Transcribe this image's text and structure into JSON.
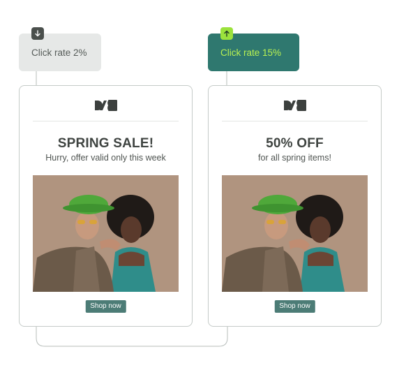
{
  "variant_a": {
    "metric_label": "Click rate 2%",
    "trend": "down",
    "trend_icon": "arrow-down-icon",
    "headline": "SPRING SALE!",
    "subline": "Hurry, offer valid only this week",
    "cta_label": "Shop now"
  },
  "variant_b": {
    "metric_label": "Click rate 15%",
    "trend": "up",
    "trend_icon": "arrow-up-icon",
    "headline": "50% OFF",
    "subline": "for all spring items!",
    "cta_label": "Shop now"
  },
  "colors": {
    "variant_a_badge": "#e6e8e7",
    "variant_b_badge": "#2f786f",
    "variant_b_badge_text": "#b9f152",
    "trend_up": "#9be23c",
    "trend_down": "#4a4f4c",
    "cta": "#4c7c76",
    "brand_logo": "#3c403e"
  },
  "icons": [
    "brand-logo-icon",
    "arrow-down-icon",
    "arrow-up-icon"
  ]
}
